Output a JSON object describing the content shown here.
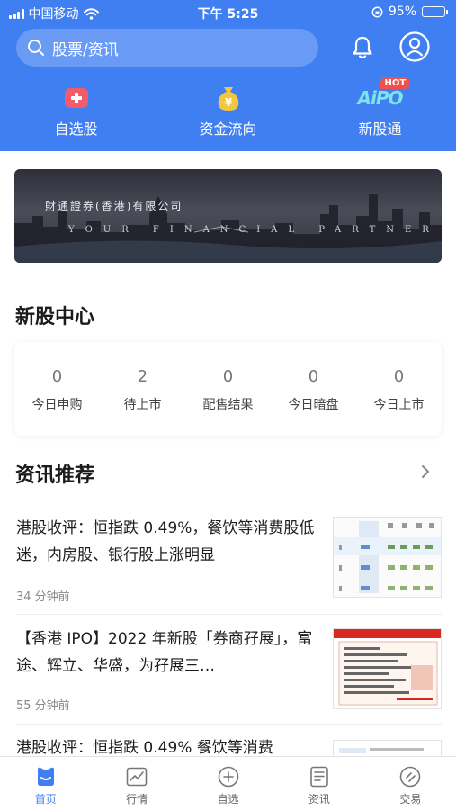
{
  "status_bar": {
    "carrier": "中国移动",
    "time": "下午 5:25",
    "battery": "95%"
  },
  "search": {
    "placeholder": "股票/资讯"
  },
  "quick_nav": [
    {
      "label": "自选股"
    },
    {
      "label": "资金流向"
    },
    {
      "label": "新股通",
      "badge": "HOT",
      "icon_text": "AiPO"
    }
  ],
  "banner": {
    "title": "財通證券(香港)有限公司",
    "subtitle": "YOUR FINANCIAL PARTNER"
  },
  "ipo_center": {
    "title": "新股中心",
    "stats": [
      {
        "value": "0",
        "label": "今日申购"
      },
      {
        "value": "2",
        "label": "待上市"
      },
      {
        "value": "0",
        "label": "配售结果"
      },
      {
        "value": "0",
        "label": "今日暗盘"
      },
      {
        "value": "0",
        "label": "今日上市"
      }
    ]
  },
  "news": {
    "title": "资讯推荐",
    "items": [
      {
        "title": "港股收评：恒指跌 0.49%，餐饮等消费股低迷，内房股、银行股上涨明显",
        "time": "34 分钟前"
      },
      {
        "title": "【香港 IPO】2022 年新股「券商孖展」，富途、辉立、华盛，为孖展三…",
        "time": "55 分钟前"
      },
      {
        "title": "港股收评：恒指跌 0.49% 餐饮等消费",
        "time": ""
      }
    ]
  },
  "tab_bar": [
    {
      "label": "首页",
      "active": true
    },
    {
      "label": "行情"
    },
    {
      "label": "自选"
    },
    {
      "label": "资讯"
    },
    {
      "label": "交易"
    }
  ],
  "colors": {
    "primary": "#3f7ff2",
    "hot": "#f2504c"
  }
}
